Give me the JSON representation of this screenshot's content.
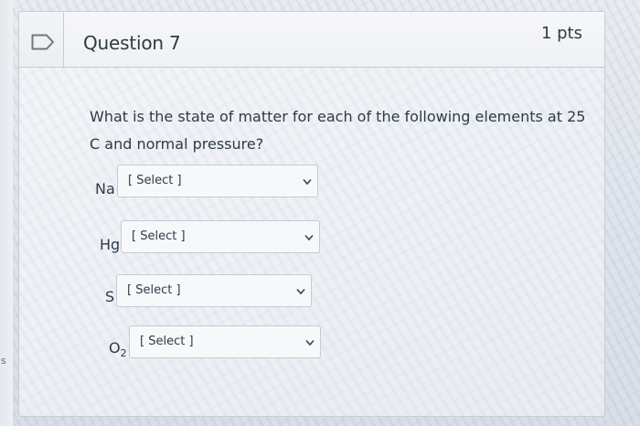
{
  "question": {
    "title": "Question 7",
    "points": "1 pts",
    "text": "What is the state of matter for each of the following elements at 25 C and normal pressure?",
    "answers": [
      {
        "symbol": "Na",
        "subscript": "",
        "selected": "[ Select ]"
      },
      {
        "symbol": "Hg",
        "subscript": "",
        "selected": "[ Select ]"
      },
      {
        "symbol": "S",
        "subscript": "",
        "selected": "[ Select ]"
      },
      {
        "symbol": "O",
        "subscript": "2",
        "selected": "[ Select ]"
      }
    ]
  },
  "page_edge": {
    "mark": "s"
  },
  "icons": {
    "flag": "bookmark-flag-icon",
    "dropdown": "chevron-down-icon"
  },
  "colors": {
    "text": "#2d3b45",
    "border": "#c7cbd1",
    "select_bg": "#f7f8fa"
  }
}
